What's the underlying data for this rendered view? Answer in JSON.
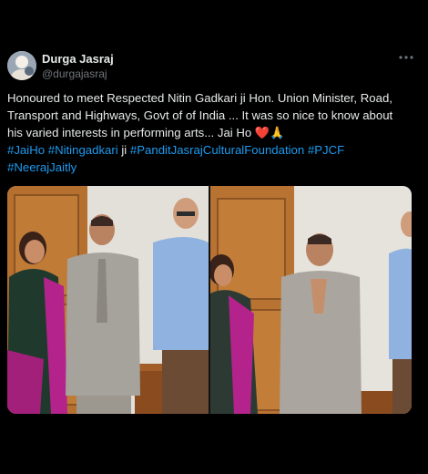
{
  "author": {
    "display_name": "Durga Jasraj",
    "handle": "@durgajasraj"
  },
  "more_icon": "more-horizontal-icon",
  "post": {
    "line1": "Honoured to meet Respected Nitin Gadkari ji  Hon. Union Minister, Road,",
    "line2": "Transport and Highways, Govt of of India ... It was so nice to know about",
    "line3_text": "his varied interests in performing arts... Jai Ho ",
    "heart": "❤️",
    "pray": "🙏",
    "tag1": "#JaiHo",
    "tag2": "#Nitingadkari",
    "ji": " ji ",
    "tag3": "#PanditJasrajCulturalFoundation",
    "tag4": "#PJCF",
    "tag5": "#NeerajJaitly"
  },
  "colors": {
    "background": "#000000",
    "text": "#e7e9ea",
    "secondary": "#71767b",
    "link": "#1d9bf0",
    "heart": "#f91880"
  },
  "media": {
    "count": 2,
    "images": [
      "group-photo-standing",
      "greeting-namaste-photo"
    ]
  }
}
